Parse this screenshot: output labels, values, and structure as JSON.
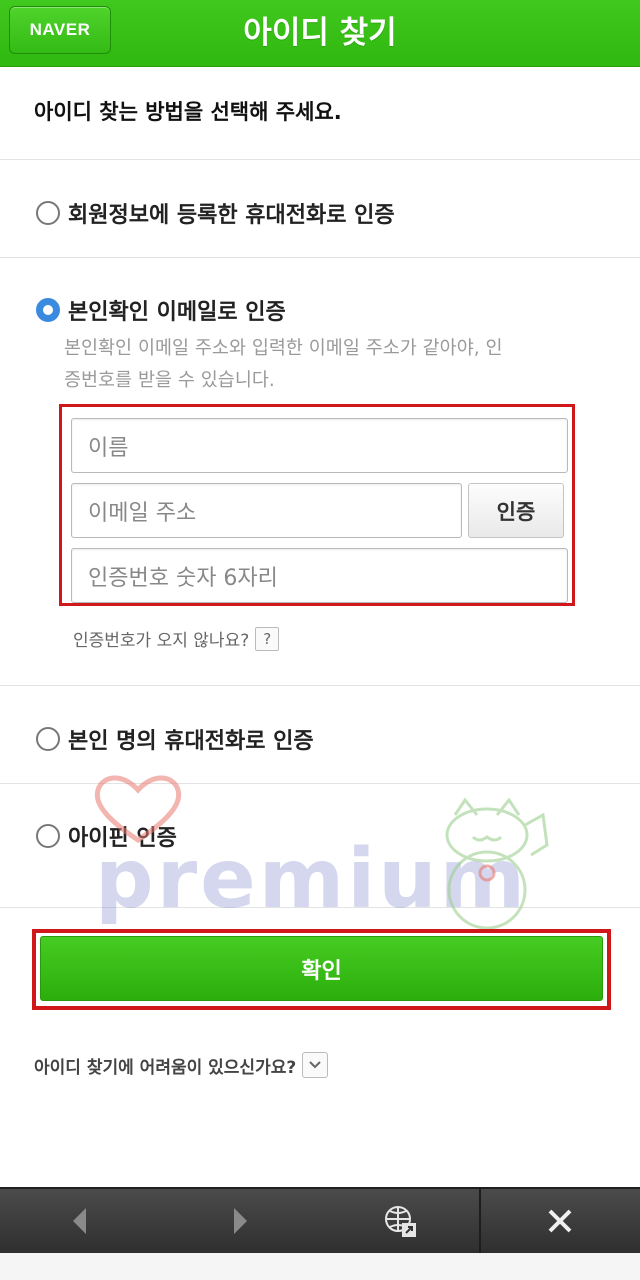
{
  "header": {
    "naver_label": "NAVER",
    "title": "아이디 찾기"
  },
  "instruction": "아이디 찾는 방법을 선택해 주세요.",
  "options": [
    {
      "label": "회원정보에 등록한 휴대전화로 인증",
      "checked": false
    },
    {
      "label": "본인확인 이메일로 인증",
      "checked": true
    },
    {
      "label": "본인 명의 휴대전화로 인증",
      "checked": false
    },
    {
      "label": "아이핀 인증",
      "checked": false
    }
  ],
  "email_section": {
    "desc_line1": "본인확인 이메일 주소와 입력한 이메일 주소가 같아야, 인",
    "desc_line2": "증번호를 받을 수 있습니다.",
    "name_placeholder": "이름",
    "email_placeholder": "이메일 주소",
    "verify_label": "인증",
    "code_placeholder": "인증번호 숫자 6자리",
    "help_text": "인증번호가 오지 않나요?",
    "help_icon": "?"
  },
  "watermark": "premium",
  "confirm_label": "확인",
  "trouble_text": "아이디 찾기에 어려움이 있으신가요?",
  "bottom_bar": {
    "icons": [
      "back-arrow-icon",
      "forward-arrow-icon",
      "globe-icon",
      "close-icon"
    ]
  },
  "colors": {
    "brand_green": "#2fb80f",
    "highlight_red": "#d0181b",
    "radio_blue": "#3a8be0"
  }
}
